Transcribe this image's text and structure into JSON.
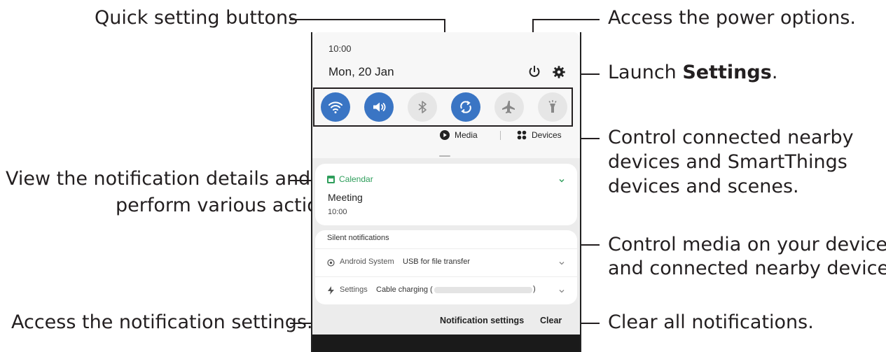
{
  "callouts": {
    "quick_settings": "Quick setting buttons",
    "view_details_line1": "View the notification details and",
    "view_details_line2": "perform various actions.",
    "access_notif_settings": "Access the notification settings.",
    "power": "Access the power options.",
    "launch_prefix": "Launch ",
    "launch_bold": "Settings",
    "launch_suffix": ".",
    "devices_line1": "Control connected nearby",
    "devices_line2": "devices and SmartThings",
    "devices_line3": "devices and scenes.",
    "media_line1": "Control media on your device",
    "media_line2": "and connected nearby devices.",
    "clear_all": "Clear all notifications."
  },
  "phone": {
    "time": "10:00",
    "date": "Mon, 20 Jan",
    "quick_settings": [
      {
        "icon": "wifi-icon",
        "state": "on"
      },
      {
        "icon": "sound-icon",
        "state": "on"
      },
      {
        "icon": "bluetooth-icon",
        "state": "off"
      },
      {
        "icon": "auto-rotate-icon",
        "state": "on"
      },
      {
        "icon": "airplane-icon",
        "state": "off"
      },
      {
        "icon": "flashlight-icon",
        "state": "off"
      }
    ],
    "media_label": "Media",
    "devices_label": "Devices",
    "calendar": {
      "app": "Calendar",
      "title": "Meeting",
      "time": "10:00"
    },
    "silent_header": "Silent notifications",
    "silent_items": [
      {
        "app": "Android System",
        "text": "USB for file transfer"
      },
      {
        "app": "Settings",
        "text": "Cable charging ("
      }
    ],
    "notification_settings": "Notification settings",
    "clear": "Clear"
  },
  "colors": {
    "accent": "#3a75c4",
    "calendar_green": "#2e9e5b",
    "line": "#231f20"
  }
}
